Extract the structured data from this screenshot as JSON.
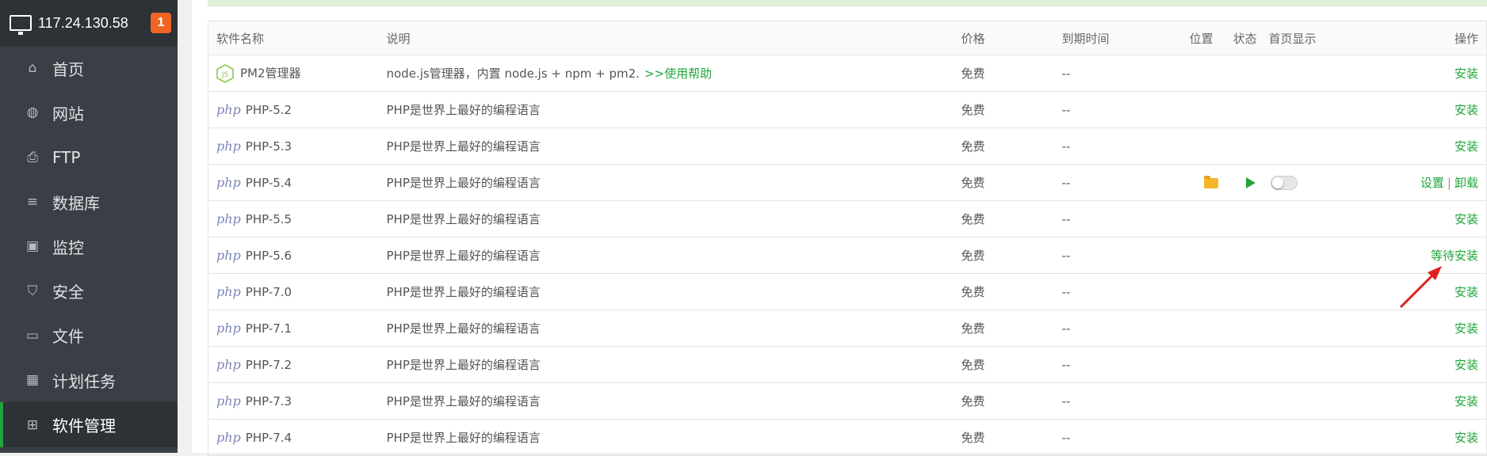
{
  "server": {
    "ip": "117.24.130.58",
    "notification_count": "1"
  },
  "sidebar": {
    "items": [
      {
        "label": "首页",
        "icon": "home-icon",
        "glyph": "⌂",
        "active": false
      },
      {
        "label": "网站",
        "icon": "globe-icon",
        "glyph": "◍",
        "active": false
      },
      {
        "label": "FTP",
        "icon": "ftp-icon",
        "glyph": "⎙",
        "active": false
      },
      {
        "label": "数据库",
        "icon": "database-icon",
        "glyph": "≡",
        "active": false
      },
      {
        "label": "监控",
        "icon": "monitor-icon",
        "glyph": "▣",
        "active": false
      },
      {
        "label": "安全",
        "icon": "shield-icon",
        "glyph": "⛉",
        "active": false
      },
      {
        "label": "文件",
        "icon": "folder-icon",
        "glyph": "▭",
        "active": false
      },
      {
        "label": "计划任务",
        "icon": "calendar-icon",
        "glyph": "▦",
        "active": false
      },
      {
        "label": "软件管理",
        "icon": "apps-grid-icon",
        "glyph": "⊞",
        "active": true
      }
    ]
  },
  "table": {
    "headers": {
      "name": "软件名称",
      "desc": "说明",
      "price": "价格",
      "expire": "到期时间",
      "position": "位置",
      "status": "状态",
      "home": "首页显示",
      "action": "操作"
    },
    "rows": [
      {
        "logo": "js",
        "name": "PM2管理器",
        "desc": "node.js管理器，内置 node.js + npm + pm2.",
        "help": ">>使用帮助",
        "price": "免费",
        "expire": "--",
        "actions": [
          "安装"
        ]
      },
      {
        "logo": "php",
        "logo_text": "php",
        "name": "PHP-5.2",
        "desc": "PHP是世界上最好的编程语言",
        "price": "免费",
        "expire": "--",
        "actions": [
          "安装"
        ]
      },
      {
        "logo": "php",
        "logo_text": "php",
        "name": "PHP-5.3",
        "desc": "PHP是世界上最好的编程语言",
        "price": "免费",
        "expire": "--",
        "actions": [
          "安装"
        ]
      },
      {
        "logo": "php",
        "logo_text": "php",
        "name": "PHP-5.4",
        "desc": "PHP是世界上最好的编程语言",
        "price": "免费",
        "expire": "--",
        "installed": true,
        "actions": [
          "设置",
          "卸载"
        ],
        "separator": "|"
      },
      {
        "logo": "php",
        "logo_text": "php",
        "name": "PHP-5.5",
        "desc": "PHP是世界上最好的编程语言",
        "price": "免费",
        "expire": "--",
        "actions": [
          "安装"
        ]
      },
      {
        "logo": "php",
        "logo_text": "php",
        "name": "PHP-5.6",
        "desc": "PHP是世界上最好的编程语言",
        "price": "免费",
        "expire": "--",
        "actions": [
          "等待安装"
        ]
      },
      {
        "logo": "php",
        "logo_text": "php",
        "name": "PHP-7.0",
        "desc": "PHP是世界上最好的编程语言",
        "price": "免费",
        "expire": "--",
        "actions": [
          "安装"
        ]
      },
      {
        "logo": "php",
        "logo_text": "php",
        "name": "PHP-7.1",
        "desc": "PHP是世界上最好的编程语言",
        "price": "免费",
        "expire": "--",
        "actions": [
          "安装"
        ]
      },
      {
        "logo": "php",
        "logo_text": "php",
        "name": "PHP-7.2",
        "desc": "PHP是世界上最好的编程语言",
        "price": "免费",
        "expire": "--",
        "actions": [
          "安装"
        ]
      },
      {
        "logo": "php",
        "logo_text": "php",
        "name": "PHP-7.3",
        "desc": "PHP是世界上最好的编程语言",
        "price": "免费",
        "expire": "--",
        "actions": [
          "安装"
        ]
      },
      {
        "logo": "php",
        "logo_text": "php",
        "name": "PHP-7.4",
        "desc": "PHP是世界上最好的编程语言",
        "price": "免费",
        "expire": "--",
        "actions": [
          "安装"
        ]
      }
    ]
  },
  "colors": {
    "accent": "#20a53a",
    "sidebar_bg": "#3a3f45",
    "badge": "#f06424",
    "annotation_arrow": "#e02020"
  }
}
